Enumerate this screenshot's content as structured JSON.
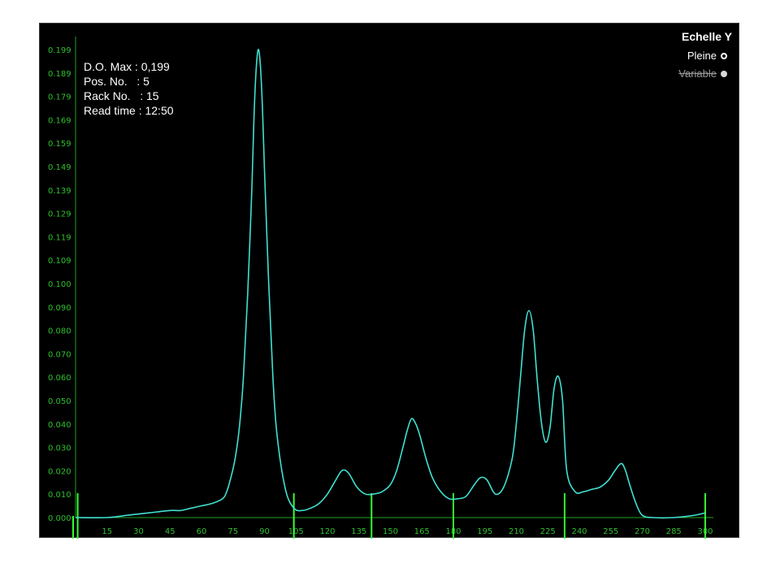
{
  "info": {
    "do_max": "D.O. Max : 0,199",
    "pos_no": "Pos. No.   : 5",
    "rack_no": "Rack No.   : 15",
    "read_time": "Read time : 12:50"
  },
  "scale": {
    "title": "Echelle Y",
    "full_label": "Pleine",
    "variable_label": "Variable"
  },
  "colors": {
    "background": "#000000",
    "trace": "#40e0d0",
    "axis": "#1fa31f",
    "tick_text": "#2fbf2f",
    "marker": "#33ff33"
  },
  "chart_data": {
    "type": "line",
    "title": "",
    "xlabel": "",
    "ylabel": "",
    "xlim": [
      0,
      300
    ],
    "ylim": [
      0,
      0.199
    ],
    "x_ticks": [
      "15",
      "30",
      "45",
      "60",
      "75",
      "90",
      "105",
      "120",
      "135",
      "150",
      "165",
      "180",
      "195",
      "210",
      "225",
      "240",
      "255",
      "270",
      "285",
      "300"
    ],
    "y_ticks": [
      "0.199",
      "0.189",
      "0.179",
      "0.169",
      "0.159",
      "0.149",
      "0.139",
      "0.129",
      "0.119",
      "0.109",
      "0.100",
      "0.090",
      "0.080",
      "0.070",
      "0.060",
      "0.050",
      "0.040",
      "0.030",
      "0.020",
      "0.010",
      "0.000"
    ],
    "series": [
      {
        "x": [
          0,
          15,
          25,
          35,
          45,
          50,
          55,
          60,
          65,
          70,
          72,
          74,
          76,
          78,
          80,
          82,
          84,
          85,
          86,
          87,
          88,
          89,
          90,
          92,
          94,
          96,
          100,
          104,
          108,
          112,
          116,
          120,
          124,
          127,
          130,
          134,
          138,
          142,
          146,
          150,
          153,
          156,
          158,
          160,
          162,
          164,
          167,
          170,
          174,
          178,
          182,
          186,
          190,
          193,
          196,
          200,
          204,
          208,
          210,
          212,
          214,
          216,
          218,
          220,
          222,
          224,
          226,
          228,
          230,
          232,
          234,
          238,
          242,
          246,
          250,
          254,
          257,
          260,
          262,
          264,
          267,
          270,
          275,
          285,
          295,
          300
        ],
        "y": [
          0.0,
          0.0,
          0.001,
          0.002,
          0.003,
          0.003,
          0.004,
          0.005,
          0.006,
          0.008,
          0.011,
          0.017,
          0.025,
          0.038,
          0.06,
          0.095,
          0.14,
          0.17,
          0.19,
          0.199,
          0.193,
          0.175,
          0.148,
          0.1,
          0.06,
          0.035,
          0.012,
          0.004,
          0.003,
          0.004,
          0.006,
          0.01,
          0.016,
          0.02,
          0.019,
          0.013,
          0.01,
          0.01,
          0.011,
          0.014,
          0.02,
          0.03,
          0.037,
          0.042,
          0.04,
          0.035,
          0.025,
          0.017,
          0.011,
          0.008,
          0.008,
          0.009,
          0.014,
          0.017,
          0.016,
          0.01,
          0.013,
          0.025,
          0.04,
          0.06,
          0.08,
          0.088,
          0.08,
          0.058,
          0.04,
          0.032,
          0.038,
          0.055,
          0.06,
          0.05,
          0.02,
          0.011,
          0.011,
          0.012,
          0.013,
          0.016,
          0.02,
          0.023,
          0.02,
          0.014,
          0.006,
          0.001,
          0.0,
          0.0,
          0.001,
          0.002
        ]
      }
    ],
    "markers_x": [
      1,
      104,
      141,
      180,
      233,
      300
    ],
    "grid": false,
    "legend": "none"
  }
}
